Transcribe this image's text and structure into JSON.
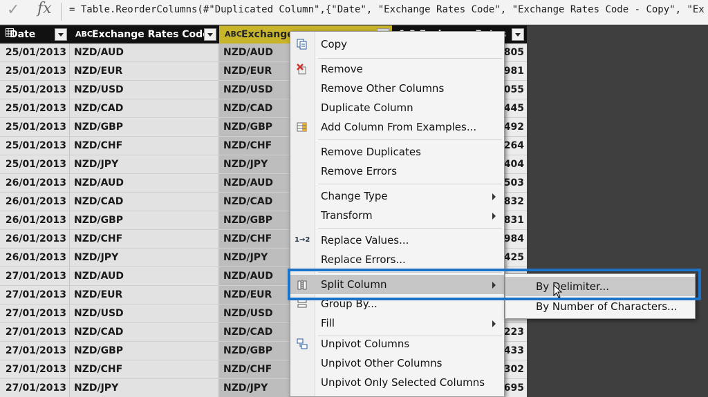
{
  "formula_bar": {
    "check_icon": "✓",
    "fx_label": "fx",
    "formula": "= Table.ReorderColumns(#\"Duplicated Column\",{\"Date\", \"Exchange Rates Code\", \"Exchange Rates Code - Copy\", \"Ex"
  },
  "grid": {
    "columns": [
      {
        "name": "Date",
        "type_icon": "table-icon",
        "selected": false
      },
      {
        "name": "Exchange Rates Code",
        "type_icon": "abc-icon",
        "type_glyph": "ABC",
        "selected": false
      },
      {
        "name": "Exchange Rates Code - Copy",
        "visible_text": "Exchange",
        "type_icon": "abc-icon",
        "type_glyph": "ABC",
        "selected": true
      },
      {
        "name": "Exchange Rates",
        "visible_text": "1.2 Exchange Rates",
        "type_icon": "decimal-icon",
        "selected": false
      }
    ],
    "rows": [
      {
        "date": "25/01/2013",
        "code": "NZD/AUD",
        "copy": "NZD/AUD",
        "rate": "3805"
      },
      {
        "date": "25/01/2013",
        "code": "NZD/EUR",
        "copy": "NZD/EUR",
        "rate": "9981"
      },
      {
        "date": "25/01/2013",
        "code": "NZD/USD",
        "copy": "NZD/USD",
        "rate": "3055"
      },
      {
        "date": "25/01/2013",
        "code": "NZD/CAD",
        "copy": "NZD/CAD",
        "rate": "3445"
      },
      {
        "date": "25/01/2013",
        "code": "NZD/GBP",
        "copy": "NZD/GBP",
        "rate": "3492"
      },
      {
        "date": "25/01/2013",
        "code": "NZD/CHF",
        "copy": "NZD/CHF",
        "rate": "2264"
      },
      {
        "date": "25/01/2013",
        "code": "NZD/JPY",
        "copy": "NZD/JPY",
        "rate": "7404"
      },
      {
        "date": "26/01/2013",
        "code": "NZD/AUD",
        "copy": "NZD/AUD",
        "rate": "1503"
      },
      {
        "date": "26/01/2013",
        "code": "NZD/CAD",
        "copy": "NZD/CAD",
        "rate": "1832"
      },
      {
        "date": "26/01/2013",
        "code": "NZD/GBP",
        "copy": "NZD/GBP",
        "rate": "3831"
      },
      {
        "date": "26/01/2013",
        "code": "NZD/CHF",
        "copy": "NZD/CHF",
        "rate": "5984"
      },
      {
        "date": "26/01/2013",
        "code": "NZD/JPY",
        "copy": "NZD/JPY",
        "rate": "0425"
      },
      {
        "date": "27/01/2013",
        "code": "NZD/AUD",
        "copy": "NZD/AUD",
        "rate": ""
      },
      {
        "date": "27/01/2013",
        "code": "NZD/EUR",
        "copy": "NZD/EUR",
        "rate": ""
      },
      {
        "date": "27/01/2013",
        "code": "NZD/USD",
        "copy": "NZD/USD",
        "rate": ""
      },
      {
        "date": "27/01/2013",
        "code": "NZD/CAD",
        "copy": "NZD/CAD",
        "rate": "1223"
      },
      {
        "date": "27/01/2013",
        "code": "NZD/GBP",
        "copy": "NZD/GBP",
        "rate": "5433"
      },
      {
        "date": "27/01/2013",
        "code": "NZD/CHF",
        "copy": "NZD/CHF",
        "rate": "5302"
      },
      {
        "date": "27/01/2013",
        "code": "NZD/JPY",
        "copy": "NZD/JPY",
        "rate": "7695"
      }
    ]
  },
  "context_menu": {
    "items": [
      {
        "label": "Copy",
        "icon": "copy-icon",
        "has_submenu": false
      },
      {
        "label": "Remove",
        "icon": "remove-icon",
        "has_submenu": false
      },
      {
        "label": "Remove Other Columns",
        "icon": "",
        "has_submenu": false
      },
      {
        "label": "Duplicate Column",
        "icon": "",
        "has_submenu": false
      },
      {
        "label": "Add Column From Examples...",
        "icon": "add-column-icon",
        "has_submenu": false
      },
      {
        "label": "Remove Duplicates",
        "icon": "",
        "has_submenu": false
      },
      {
        "label": "Remove Errors",
        "icon": "",
        "has_submenu": false
      },
      {
        "label": "Change Type",
        "icon": "",
        "has_submenu": true
      },
      {
        "label": "Transform",
        "icon": "",
        "has_submenu": true
      },
      {
        "label": "Replace Values...",
        "icon": "replace-values-icon",
        "has_submenu": false
      },
      {
        "label": "Replace Errors...",
        "icon": "",
        "has_submenu": false
      },
      {
        "label": "Split Column",
        "icon": "split-column-icon",
        "has_submenu": true,
        "highlighted": true
      },
      {
        "label": "Group By...",
        "icon": "group-by-icon",
        "has_submenu": false
      },
      {
        "label": "Fill",
        "icon": "",
        "has_submenu": true
      },
      {
        "label": "Unpivot Columns",
        "icon": "unpivot-icon",
        "has_submenu": false
      },
      {
        "label": "Unpivot Other Columns",
        "icon": "",
        "has_submenu": false
      },
      {
        "label": "Unpivot Only Selected Columns",
        "icon": "",
        "has_submenu": false
      }
    ],
    "replace_values_glyph": "1→2"
  },
  "submenu": {
    "items": [
      {
        "label": "By Delimiter...",
        "highlighted": true
      },
      {
        "label": "By Number of Characters...",
        "highlighted": false
      }
    ]
  },
  "colors": {
    "selected_header": "#c9b52a",
    "highlight_frame": "#1a73c9",
    "header_bg": "#111111"
  }
}
